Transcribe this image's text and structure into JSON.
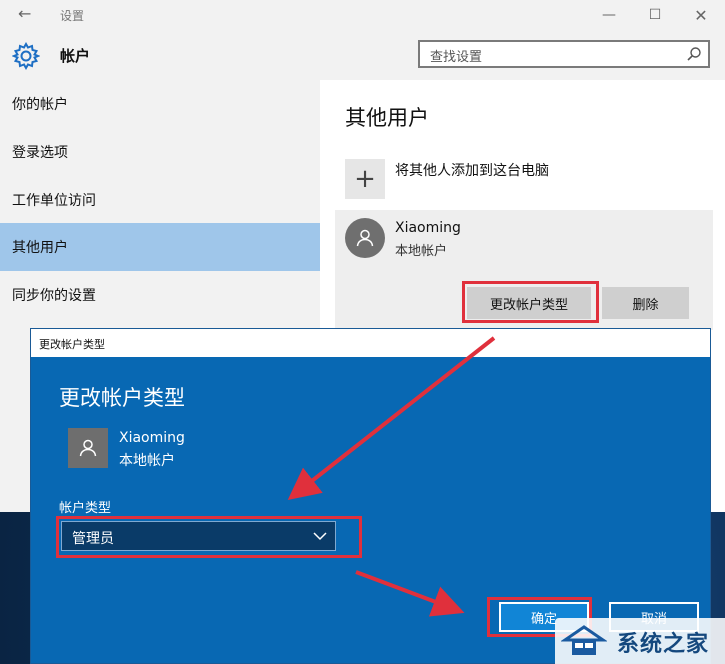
{
  "window": {
    "title": "设置",
    "back_glyph": "←",
    "min_glyph": "—",
    "max_glyph": "☐",
    "close_glyph": "✕"
  },
  "header": {
    "title": "帐户",
    "search_placeholder": "查找设置"
  },
  "sidebar": {
    "items": [
      {
        "label": "你的帐户"
      },
      {
        "label": "登录选项"
      },
      {
        "label": "工作单位访问"
      },
      {
        "label": "其他用户",
        "selected": true
      },
      {
        "label": "同步你的设置"
      }
    ]
  },
  "main": {
    "title": "其他用户",
    "add_icon": "+",
    "add_label": "将其他人添加到这台电脑",
    "user": {
      "name": "Xiaoming",
      "type": "本地帐户"
    },
    "change_type_button": "更改帐户类型",
    "delete_button": "删除"
  },
  "dialog": {
    "window_title": "更改帐户类型",
    "heading": "更改帐户类型",
    "user": {
      "name": "Xiaoming",
      "type": "本地帐户"
    },
    "account_type_label": "帐户类型",
    "account_type_value": "管理员",
    "ok_button": "确定",
    "cancel_button": "取消"
  },
  "colors": {
    "selected_nav": "#9fc6ea",
    "dialog_bg": "#0868b3",
    "annotation_red": "#e0303c"
  },
  "watermark": {
    "text": "系统之家"
  }
}
